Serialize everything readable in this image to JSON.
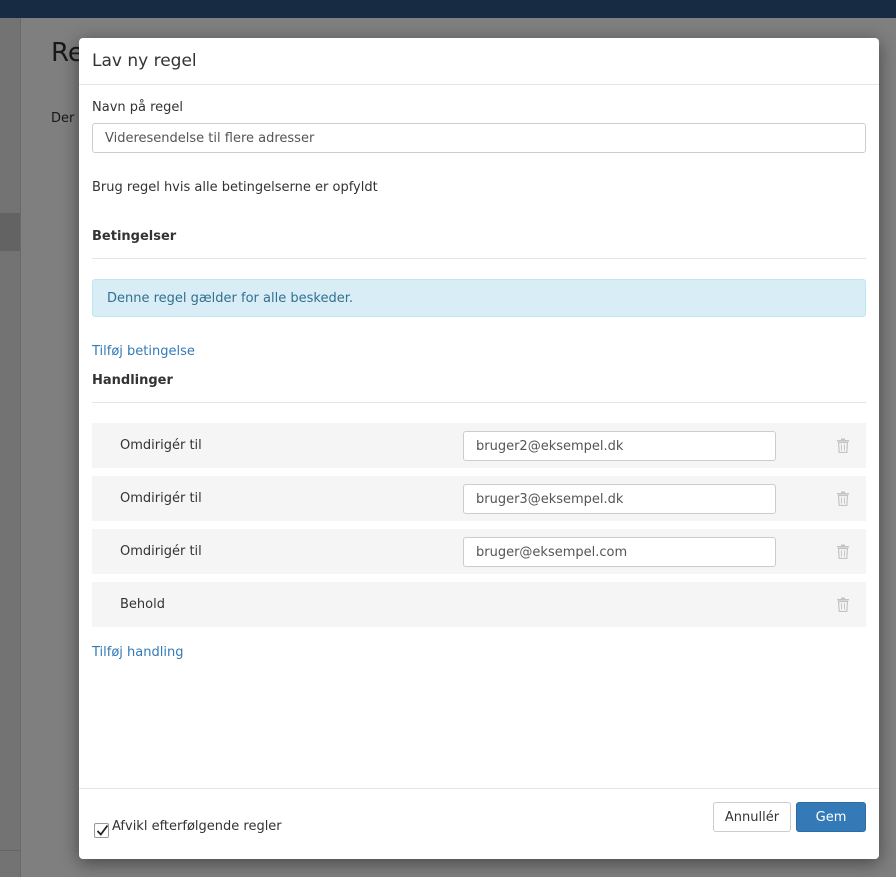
{
  "background": {
    "title_partial": "Re",
    "text_partial": "Der"
  },
  "modal": {
    "title": "Lav ny regel",
    "name_label": "Navn på regel",
    "name_value": "Videresendelse til flere adresser",
    "condition_mode": "Brug regel hvis alle betingelserne er opfyldt",
    "conditions": {
      "heading": "Betingelser",
      "info": "Denne regel gælder for alle beskeder.",
      "add_link": "Tilføj betingelse"
    },
    "actions": {
      "heading": "Handlinger",
      "items": [
        {
          "label": "Omdirigér til",
          "value": "bruger2@eksempel.dk"
        },
        {
          "label": "Omdirigér til",
          "value": "bruger3@eksempel.dk"
        },
        {
          "label": "Omdirigér til",
          "value": "bruger@eksempel.com"
        },
        {
          "label": "Behold"
        }
      ],
      "add_link": "Tilføj handling"
    },
    "footer": {
      "stop_label": "Afvikl efterfølgende regler",
      "stop_checked": true,
      "cancel_label": "Annullér",
      "save_label": "Gem"
    }
  },
  "icons": {
    "delete": "trash-icon",
    "checkbox": "checkmark-icon"
  },
  "colors": {
    "topbar": "#2e5787",
    "primary": "#337ab7",
    "info_bg": "#d9edf7",
    "info_text": "#31708f",
    "row_bg": "#f5f5f5"
  }
}
